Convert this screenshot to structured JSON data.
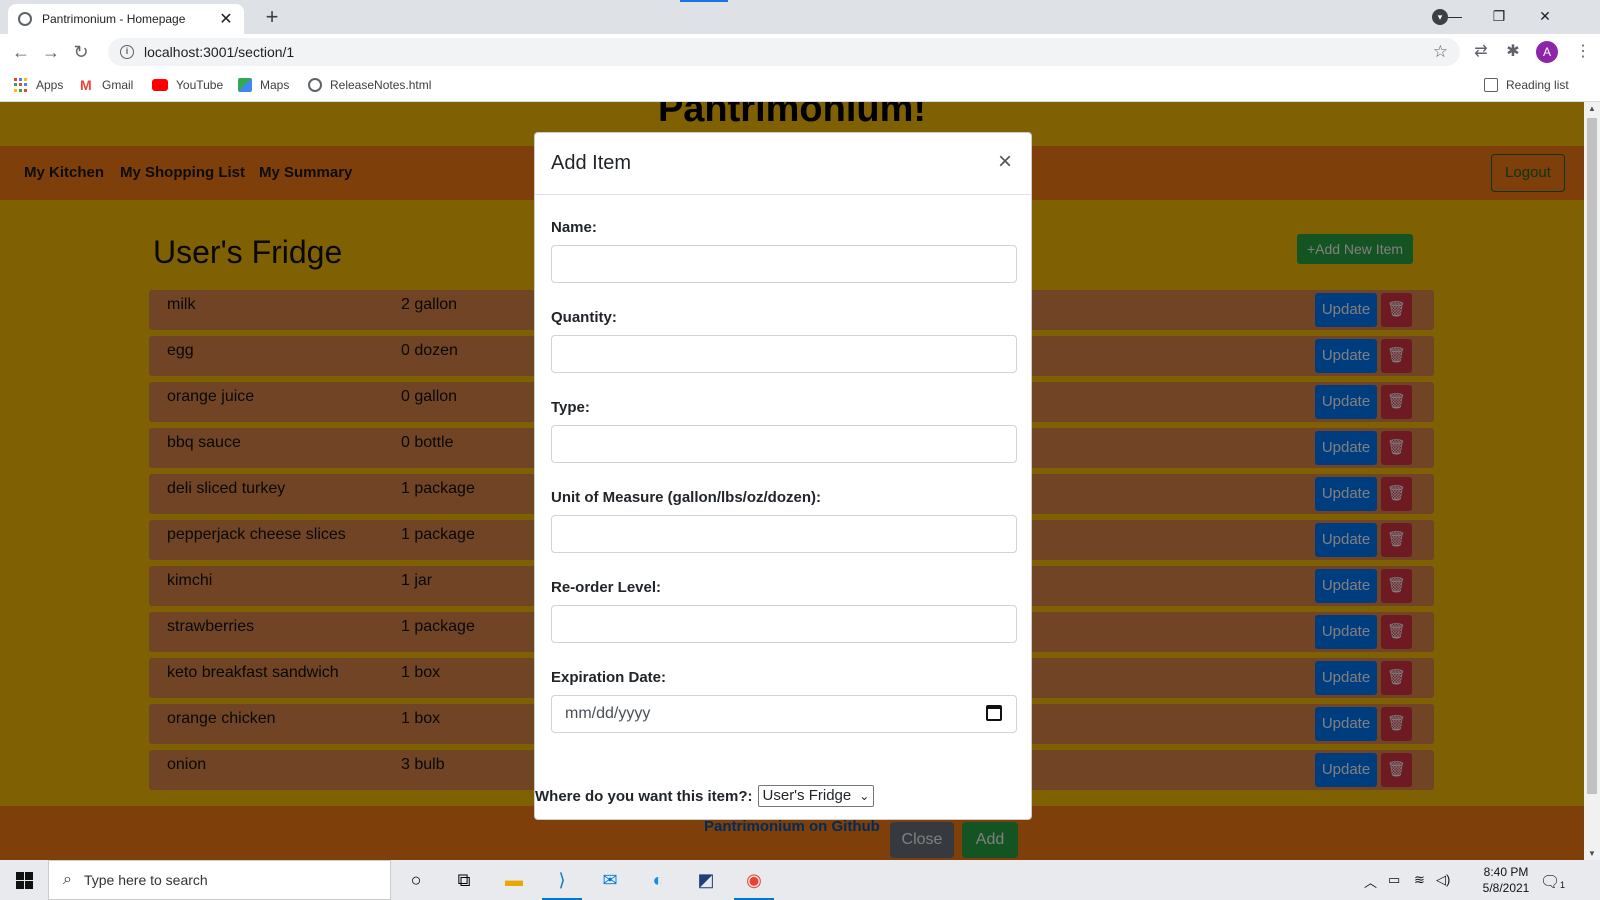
{
  "browser": {
    "tab_title": "Pantrimonium - Homepage",
    "url": "localhost:3001/section/1",
    "bookmarks": [
      "Apps",
      "Gmail",
      "YouTube",
      "Maps",
      "ReleaseNotes.html"
    ],
    "reading_list": "Reading list",
    "profile_initial": "A"
  },
  "app": {
    "title": "Pantrimonium!",
    "nav": [
      "My Kitchen",
      "My Shopping List",
      "My Summary"
    ],
    "logout": "Logout",
    "section_title": "User's Fridge",
    "add_new": "+Add New Item",
    "update_label": "Update",
    "items": [
      {
        "name": "milk",
        "qty": "2 gallon"
      },
      {
        "name": "egg",
        "qty": "0 dozen"
      },
      {
        "name": "orange juice",
        "qty": "0 gallon"
      },
      {
        "name": "bbq sauce",
        "qty": "0 bottle"
      },
      {
        "name": "deli sliced turkey",
        "qty": "1 package"
      },
      {
        "name": "pepperjack cheese slices",
        "qty": "1 package"
      },
      {
        "name": "kimchi",
        "qty": "1 jar"
      },
      {
        "name": "strawberries",
        "qty": "1 package"
      },
      {
        "name": "keto breakfast sandwich",
        "qty": "1 box"
      },
      {
        "name": "orange chicken",
        "qty": "1 box"
      },
      {
        "name": "onion",
        "qty": "3 bulb"
      }
    ],
    "footer": {
      "github": "Pantrimonium on Github",
      "close": "Close",
      "add": "Add"
    }
  },
  "modal": {
    "title": "Add Item",
    "close_glyph": "×",
    "fields": [
      {
        "label": "Name:",
        "value": ""
      },
      {
        "label": "Quantity:",
        "value": ""
      },
      {
        "label": "Type:",
        "value": ""
      },
      {
        "label": "Unit of Measure (gallon/lbs/oz/dozen):",
        "value": ""
      },
      {
        "label": "Re-order Level:",
        "value": ""
      },
      {
        "label": "Expiration Date:",
        "value": "mm/dd/yyyy"
      }
    ],
    "location_label": "Where do you want this item?:",
    "location_value": "User's Fridge"
  },
  "taskbar": {
    "search_placeholder": "Type here to search",
    "time": "8:40 PM",
    "date": "5/8/2021",
    "notification_count": "1"
  },
  "colors": {
    "page_bg": "#ffc107",
    "nav_bg": "#fd7e14",
    "update": "#007bff",
    "delete": "#dc3545",
    "success": "#28a745"
  }
}
